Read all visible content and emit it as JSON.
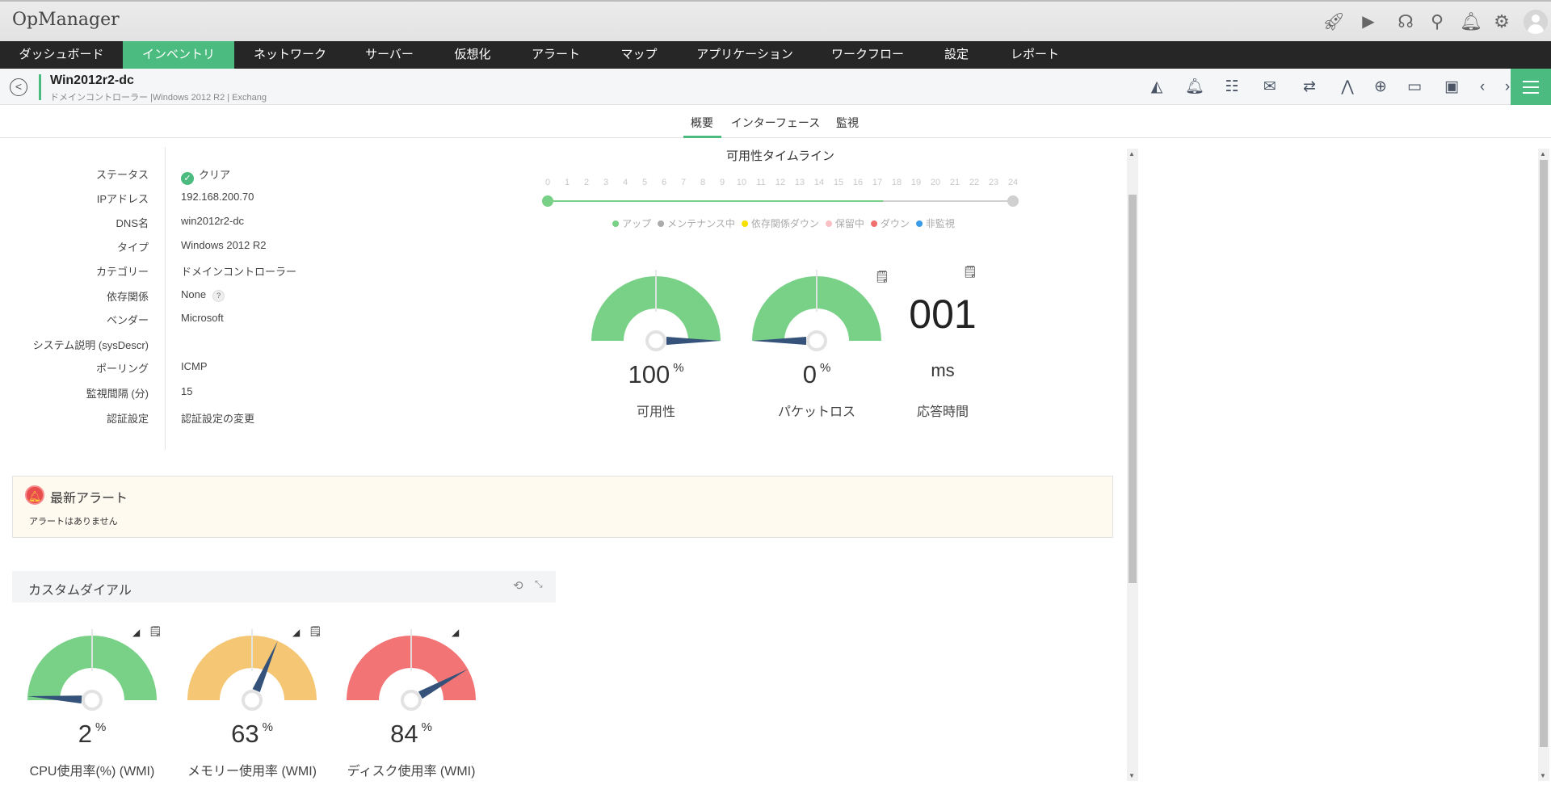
{
  "app": {
    "title": "OpManager"
  },
  "top_icons": [
    "rocket-icon",
    "presentation-icon",
    "headset-icon",
    "search-icon",
    "bell-icon",
    "gear-icon",
    "avatar"
  ],
  "nav": [
    {
      "label": "ダッシュボード"
    },
    {
      "label": "インベントリ",
      "active": true
    },
    {
      "label": "ネットワーク"
    },
    {
      "label": "サーバー"
    },
    {
      "label": "仮想化"
    },
    {
      "label": "アラート"
    },
    {
      "label": "マップ"
    },
    {
      "label": "アプリケーション"
    },
    {
      "label": "ワークフロー"
    },
    {
      "label": "設定"
    },
    {
      "label": "レポート"
    }
  ],
  "device": {
    "name": "Win2012r2-dc",
    "subtitle": "ドメインコントローラー |Windows 2012 R2 | Exchang"
  },
  "toolbar_icons": [
    "graph-icon",
    "alarm-icon",
    "workflow-icon",
    "mail-icon",
    "sync-icon",
    "topology-icon",
    "globe-icon",
    "remote-desktop-icon",
    "terminal-icon",
    "prev-icon",
    "next-icon",
    "menu-icon"
  ],
  "tabs": [
    "概要",
    "インターフェース",
    "監視"
  ],
  "info": [
    {
      "label": "ステータス",
      "value": "クリア"
    },
    {
      "label": "IPアドレス",
      "value": "192.168.200.70"
    },
    {
      "label": "DNS名",
      "value": "win2012r2-dc"
    },
    {
      "label": "タイプ",
      "value": "Windows 2012 R2"
    },
    {
      "label": "カテゴリー",
      "value": "ドメインコントローラー"
    },
    {
      "label": "依存関係",
      "value": "None"
    },
    {
      "label": "ベンダー",
      "value": "Microsoft"
    },
    {
      "label": "システム説明 (sysDescr)",
      "value": ""
    },
    {
      "label": "ポーリング",
      "value": "ICMP"
    },
    {
      "label": "監視間隔 (分)",
      "value": "15"
    },
    {
      "label": "認証設定",
      "value": "認証設定の変更"
    }
  ],
  "help_mark": "?",
  "timeline": {
    "title": "可用性タイムライン",
    "hours": [
      "0",
      "1",
      "2",
      "3",
      "4",
      "5",
      "6",
      "7",
      "8",
      "9",
      "10",
      "11",
      "12",
      "13",
      "14",
      "15",
      "16",
      "17",
      "18",
      "19",
      "20",
      "21",
      "22",
      "23",
      "24"
    ],
    "up_until_hour": 17.3,
    "legend": [
      {
        "label": "アップ",
        "color": "#78d187"
      },
      {
        "label": "メンテナンス中",
        "color": "#aaaaaa"
      },
      {
        "label": "依存関係ダウン",
        "color": "#f5e000"
      },
      {
        "label": "保留中",
        "color": "#f9c0c3"
      },
      {
        "label": "ダウン",
        "color": "#f07070"
      },
      {
        "label": "非監視",
        "color": "#3a9be8"
      }
    ]
  },
  "gauges": [
    {
      "value": 100,
      "display": "100",
      "unit": "%",
      "label": "可用性",
      "color": "#78d187"
    },
    {
      "value": 0,
      "display": "0",
      "unit": "%",
      "label": "パケットロス",
      "color": "#78d187"
    }
  ],
  "response": {
    "value": "001",
    "unit": "ms",
    "label": "応答時間"
  },
  "alerts": {
    "title": "最新アラート",
    "message": "アラートはありません"
  },
  "custom_dials": {
    "title": "カスタムダイアル",
    "dials": [
      {
        "value": 2,
        "display": "2",
        "unit": "%",
        "label": "CPU使用率(%) (WMI)",
        "color": "#78d187"
      },
      {
        "value": 63,
        "display": "63",
        "unit": "%",
        "label": "メモリー使用率 (WMI)",
        "color": "#f5c674"
      },
      {
        "value": 84,
        "display": "84",
        "unit": "%",
        "label": "ディスク使用率 (WMI)",
        "color": "#f27474"
      }
    ]
  },
  "colors": {
    "accent": "#4cbb7f",
    "nav_bg": "#262626",
    "needle": "#34527a"
  }
}
